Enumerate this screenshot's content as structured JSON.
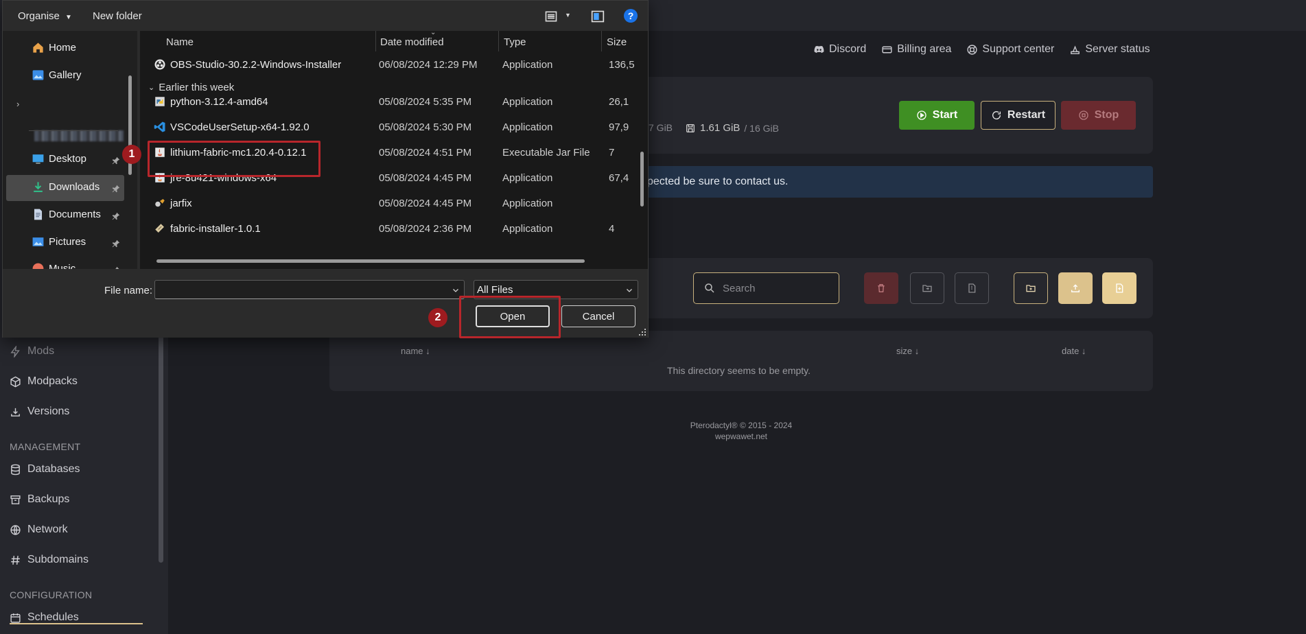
{
  "colors": {
    "accent": "#dcc28c",
    "start_green": "#3f8f23",
    "stop_red": "#6a2a2f",
    "annotation_red": "#b8262b",
    "alert_blue": "#223248"
  },
  "header": {
    "links": [
      {
        "label": "Discord",
        "icon": "discord-icon"
      },
      {
        "label": "Billing area",
        "icon": "card-icon"
      },
      {
        "label": "Support center",
        "icon": "lifebuoy-icon"
      },
      {
        "label": "Server status",
        "icon": "server-icon"
      }
    ]
  },
  "server": {
    "buttons": {
      "start": "Start",
      "restart": "Restart",
      "stop": "Stop"
    },
    "stats": {
      "partial_memory": "7 GiB",
      "disk_used": "1.61 GiB",
      "disk_total": "/ 16 GiB"
    },
    "alert_text": "pected be sure to contact us."
  },
  "files": {
    "search_placeholder": "Search",
    "columns": {
      "name": "name ↓",
      "size": "size ↓",
      "date": "date ↓"
    },
    "empty_message": "This directory seems to be empty."
  },
  "footer": {
    "line1": "Pterodactyl® © 2015 - 2024",
    "line2": "wepwawet.net"
  },
  "sidebar": {
    "items": [
      {
        "label": "Mods",
        "icon": "mods-icon"
      },
      {
        "label": "Modpacks",
        "icon": "cube-icon"
      },
      {
        "label": "Versions",
        "icon": "download-icon"
      }
    ],
    "management_heading": "MANAGEMENT",
    "management_items": [
      {
        "label": "Databases",
        "icon": "database-icon"
      },
      {
        "label": "Backups",
        "icon": "archive-icon"
      },
      {
        "label": "Network",
        "icon": "globe-icon"
      },
      {
        "label": "Subdomains",
        "icon": "hash-icon"
      }
    ],
    "configuration_heading": "CONFIGURATION",
    "configuration_items": [
      {
        "label": "Schedules",
        "icon": "calendar-icon"
      }
    ]
  },
  "dialog": {
    "toolbar": {
      "organise": "Organise",
      "new_folder": "New folder"
    },
    "nav": {
      "home": "Home",
      "gallery": "Gallery",
      "desktop": "Desktop",
      "downloads": "Downloads",
      "documents": "Documents",
      "pictures": "Pictures",
      "music": "Music"
    },
    "columns": {
      "name": "Name",
      "date": "Date modified",
      "type": "Type",
      "size": "Size"
    },
    "group_label": "Earlier this week",
    "files": [
      {
        "name": "OBS-Studio-30.2.2-Windows-Installer",
        "date": "06/08/2024 12:29 PM",
        "type": "Application",
        "size": "136,5",
        "icon": "obs-icon"
      },
      {
        "name": "python-3.12.4-amd64",
        "date": "05/08/2024 5:35 PM",
        "type": "Application",
        "size": "26,1",
        "icon": "python-icon"
      },
      {
        "name": "VSCodeUserSetup-x64-1.92.0",
        "date": "05/08/2024 5:30 PM",
        "type": "Application",
        "size": "97,9",
        "icon": "vscode-icon"
      },
      {
        "name": "lithium-fabric-mc1.20.4-0.12.1",
        "date": "05/08/2024 4:51 PM",
        "type": "Executable Jar File",
        "size": "7",
        "icon": "java-icon"
      },
      {
        "name": "jre-8u421-windows-x64",
        "date": "05/08/2024 4:45 PM",
        "type": "Application",
        "size": "67,4",
        "icon": "java-installer-icon"
      },
      {
        "name": "jarfix",
        "date": "05/08/2024 4:45 PM",
        "type": "Application",
        "size": "",
        "icon": "jarfix-icon"
      },
      {
        "name": "fabric-installer-1.0.1",
        "date": "05/08/2024 2:36 PM",
        "type": "Application",
        "size": "4",
        "icon": "fabric-icon"
      }
    ],
    "file_name_label": "File name:",
    "file_name_value": "",
    "file_type": "All Files",
    "open": "Open",
    "cancel": "Cancel"
  },
  "annotations": {
    "step1": "1",
    "step2": "2"
  }
}
